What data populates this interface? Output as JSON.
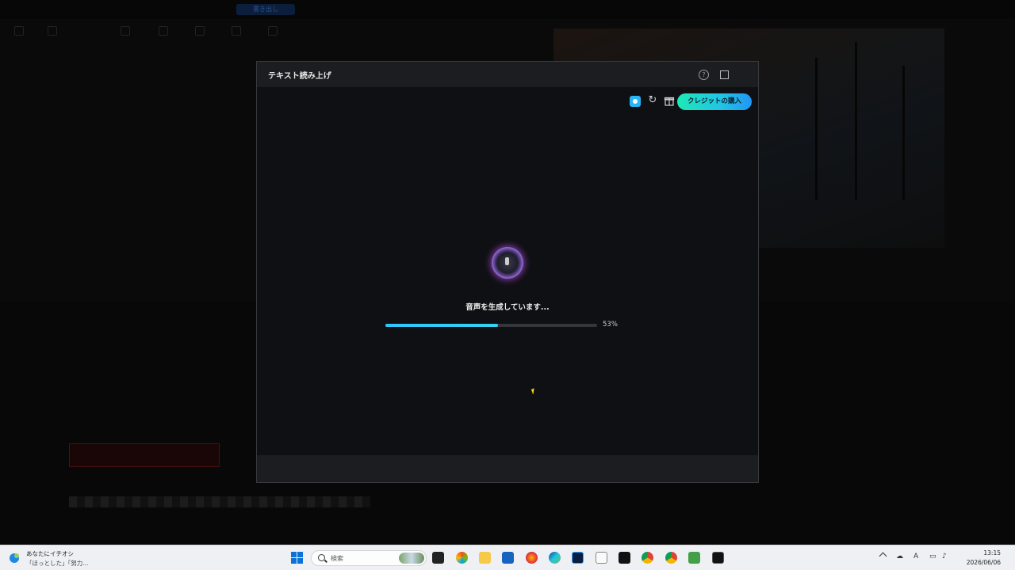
{
  "background_app": {
    "export_button": "書き出し"
  },
  "dialog": {
    "title": "テキスト読み上げ",
    "help_icon": "question-circle-icon",
    "maximize_icon": "maximize-icon",
    "buy_credits_label": "クレジットの購入",
    "status_text": "音声を生成しています...",
    "progress_percent_label": "53%",
    "progress_value": 0.53,
    "accent_color": "#22c3e6"
  },
  "taskbar": {
    "news_title": "あなたにイチオシ",
    "news_subtitle": "「ほっとした」「努力...",
    "search_placeholder": "検索",
    "clock_time": "13:15",
    "clock_date": "2026/06/06",
    "tray_input_indicator": "A"
  }
}
